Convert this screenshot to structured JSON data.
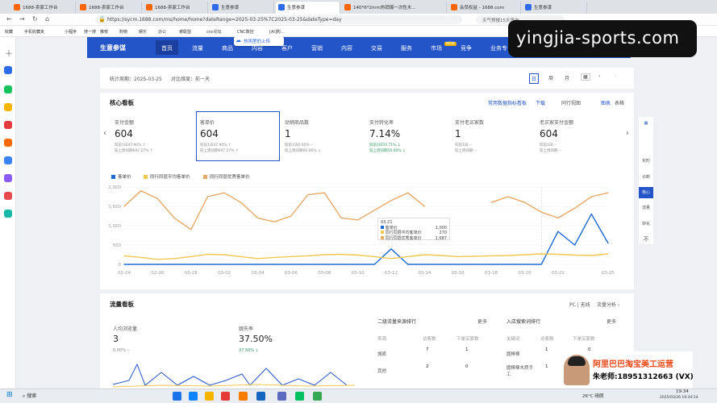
{
  "browser": {
    "tabs": [
      {
        "label": "1688-卖家工作台"
      },
      {
        "label": "1688-卖家工作台"
      },
      {
        "label": "1688-卖家工作台"
      },
      {
        "label": "生意参谋"
      },
      {
        "label": "生意参谋"
      },
      {
        "label": "140*6*2mm热销爆一次性木..."
      },
      {
        "label": "会员权益 - 1688.com"
      },
      {
        "label": "生意参谋"
      }
    ],
    "url": "https://sycm.1688.com/ms/home/home?dateRange=2025-03-25%7C2025-03-25&dateType=day",
    "search_placeholder": "天气预报15天查询",
    "bookmarks": [
      "收藏",
      "手机收藏夹",
      "小程序",
      "搜一搜",
      "推荐",
      "购物",
      "娱乐",
      "办公",
      "被联盟",
      "cnc论坛",
      "CNC数控",
      "[AI]购..."
    ]
  },
  "cloud_popup": "热闹里的上传",
  "nav": {
    "brand": "生意参谋",
    "items": [
      "首页",
      "流量",
      "商品",
      "内容",
      "客户",
      "营销",
      "内容",
      "交易",
      "服务",
      "市场",
      "竞争",
      "业务专"
    ],
    "new_badge": "NEW"
  },
  "period": {
    "stat_label": "统计周期：2025-03-25",
    "compare_label": "对比维度：前一天",
    "buttons": [
      "日",
      "周",
      "月"
    ]
  },
  "core": {
    "title": "核心看板",
    "actions": [
      "常用数据指标看板",
      "下载",
      "同行视图",
      "图表",
      "表格"
    ],
    "metrics": [
      {
        "label": "支付金额",
        "value": "604",
        "line1": "较前1日47.90% ↑",
        "line2": "较上周同期697.27% ↑"
      },
      {
        "label": "客单价",
        "value": "604",
        "line1": "较前1日47.90% ↑",
        "line2": "较上周同期697.27% ↑"
      },
      {
        "label": "动销商品数",
        "value": "1",
        "line1": "较前1日0.00% --",
        "line2": "较上周同期66.66% ↓"
      },
      {
        "label": "支付转化率",
        "value": "7.14%",
        "line1": "较前1日33.71% ↓",
        "line2": "较上周同期50.00% ↓"
      },
      {
        "label": "支付老买家数",
        "value": "1",
        "line1": "较前1日 --",
        "line2": "较上周同期 --"
      },
      {
        "label": "老买家支付金额",
        "value": "604",
        "line1": "较前1日 --",
        "line2": "较上周同期 --"
      }
    ],
    "legend": [
      "客单价",
      "同行同层平均客单价",
      "同行同层优秀客单价"
    ]
  },
  "chart_data": {
    "type": "line",
    "x": [
      "02-24",
      "02-25",
      "02-26",
      "02-27",
      "02-28",
      "03-01",
      "03-02",
      "03-03",
      "03-04",
      "03-05",
      "03-06",
      "03-07",
      "03-08",
      "03-09",
      "03-10",
      "03-11",
      "03-12",
      "03-13",
      "03-14",
      "03-15",
      "03-16",
      "03-17",
      "03-18",
      "03-19",
      "03-20",
      "03-21",
      "03-22",
      "03-23",
      "03-24",
      "03-25"
    ],
    "ticks": [
      "02-24",
      "02-26",
      "02-28",
      "03-02",
      "03-04",
      "03-06",
      "03-08",
      "03-10",
      "03-12",
      "03-14",
      "03-16",
      "03-18",
      "03-20",
      "03-22",
      "03-25"
    ],
    "ylim": [
      0,
      2000
    ],
    "yticks": [
      "0",
      "500",
      "1,000",
      "1,500",
      "2,000"
    ],
    "series": [
      {
        "name": "客单价",
        "color": "#1f6bd0",
        "values": [
          0,
          0,
          0,
          0,
          0,
          0,
          0,
          0,
          0,
          0,
          0,
          0,
          0,
          0,
          0,
          0,
          400,
          0,
          0,
          0,
          0,
          0,
          0,
          0,
          0,
          0,
          850,
          500,
          1300,
          550
        ]
      },
      {
        "name": "同行同层平均客单价",
        "color": "#f0c850",
        "values": [
          220,
          180,
          130,
          150,
          200,
          260,
          250,
          200,
          150,
          180,
          200,
          220,
          250,
          260,
          240,
          200,
          150,
          200,
          250,
          230,
          200,
          210,
          220,
          230,
          250,
          270,
          260,
          240,
          230,
          270
        ]
      },
      {
        "name": "同行同层优秀客单价",
        "color": "#e8a868",
        "values": [
          1500,
          1900,
          1700,
          1200,
          900,
          1750,
          1850,
          1600,
          1200,
          1100,
          1250,
          1800,
          1850,
          1200,
          1150,
          1400,
          1650,
          1850,
          1500,
          null,
          null,
          null,
          1600,
          1750,
          1600,
          1350,
          1200,
          1450,
          1750,
          1850
        ]
      }
    ],
    "tooltip": {
      "date": "03-21",
      "rows": [
        {
          "name": "客单价",
          "value": "1,000"
        },
        {
          "name": "同行同层平均客单价",
          "value": "270"
        },
        {
          "name": "同行同层优秀客单价",
          "value": "1,687"
        }
      ]
    }
  },
  "right_bar": [
    "实时",
    "诊断",
    "核心",
    "流量",
    "转化",
    "不"
  ],
  "flow": {
    "title": "流量看板",
    "pc_label": "PC | 无线",
    "analysis_label": "流量分析 ›",
    "visitors_label": "人均浏览量",
    "visitors_value": "3",
    "visitors_change": "0.00% --",
    "bounce_label": "跳失率",
    "bounce_value": "37.50%",
    "bounce_change": "37.50% ↓",
    "source_title": "二级流量来源排行",
    "source_more": "更多",
    "source_cols": [
      "来源",
      "访客数",
      "下单买家数"
    ],
    "source_rows": [
      [
        "搜索",
        "7",
        "1"
      ],
      [
        "其他",
        "2",
        "0"
      ]
    ],
    "search_title": "入店搜索词排行",
    "search_more": "更多",
    "search_cols": [
      "关键词",
      "访客数",
      "下单买家数"
    ],
    "search_rows": [
      [
        "圆棒棒",
        "1",
        "0"
      ],
      [
        "圆棒棒木质手工",
        "1",
        "0"
      ]
    ]
  },
  "promo": {
    "site": "yingjia-sports.com",
    "teacher_title": "阿里巴巴淘宝美工运营",
    "teacher_contact": "朱老师:18951312663 (VX)"
  },
  "taskbar": {
    "search": "搜索",
    "weather": "26°C 晴朗",
    "time": "19:34",
    "date": "2025/03/26 19:34:14"
  }
}
